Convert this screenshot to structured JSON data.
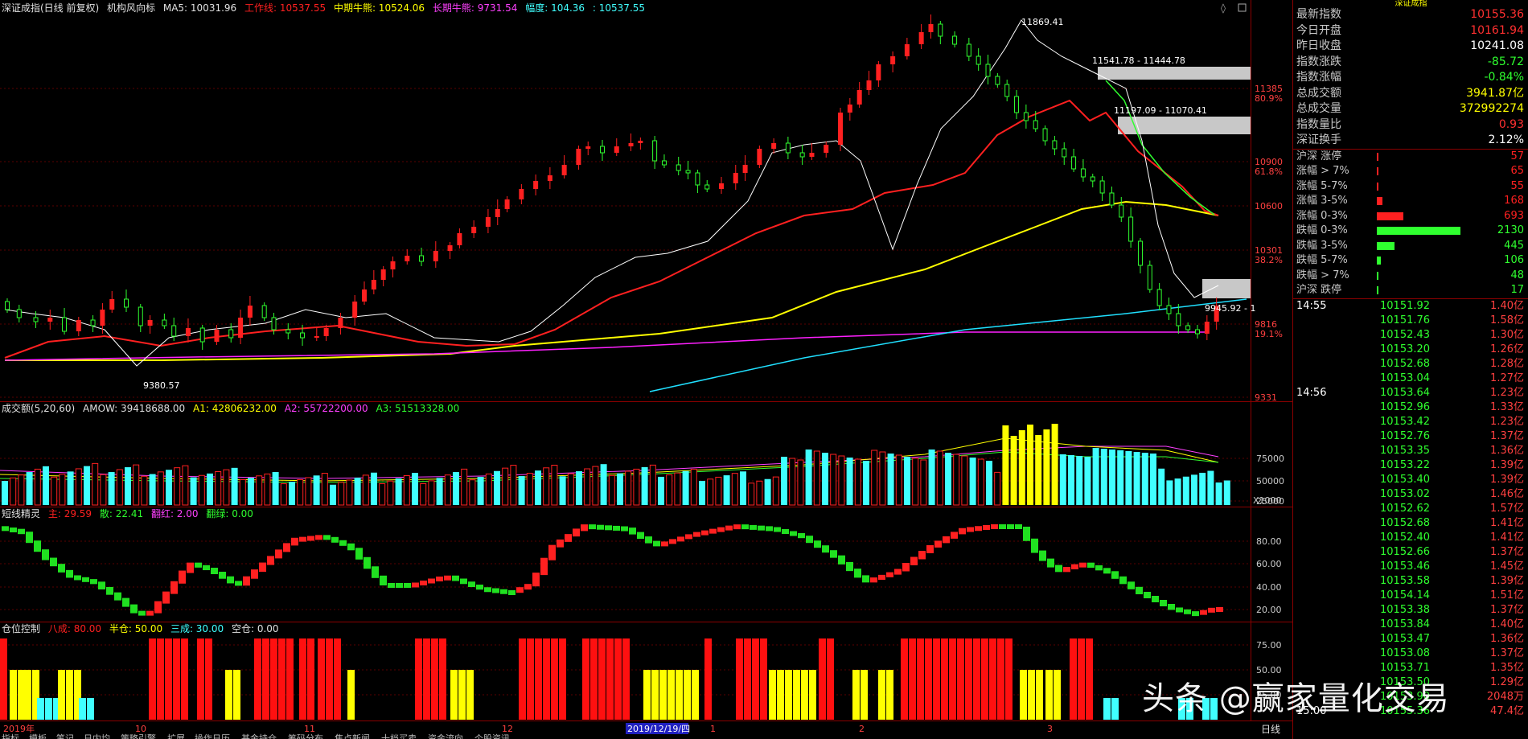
{
  "chart_header": {
    "name": "深证成指(日线 前复权)",
    "indicator": "机构风向标",
    "ma5": "MA5: 10031.96",
    "work": "工作线: 10537.55",
    "mid": "中期牛熊: 10524.06",
    "long": "长期牛熊: 9731.54",
    "amp": "幅度: 104.36",
    "last": ": 10537.55"
  },
  "price_labels": {
    "high": "11869.41",
    "zone1": "11541.78 - 11444.78",
    "zone2": "11197.09 - 11070.41",
    "low": "9380.57",
    "right": "9945.92 - 1"
  },
  "price_axis": [
    {
      "v": "11385",
      "p": "80.9%"
    },
    {
      "v": "10900",
      "p": "61.8%"
    },
    {
      "v": "10600",
      "p": ""
    },
    {
      "v": "10301",
      "p": "38.2%"
    },
    {
      "v": "9816",
      "p": "19.1%"
    },
    {
      "v": "9331",
      "p": ""
    }
  ],
  "volume_header": {
    "name": "成交额(5,20,60)",
    "amow": "AMOW: 39418688.00",
    "a1": "A1: 42806232.00",
    "a2": "A2: 55722200.00",
    "a3": "A3: 51513328.00"
  },
  "volume_axis": [
    "75000",
    "50000",
    "25000"
  ],
  "volume_unit": "X1000",
  "osc_header": {
    "name": "短线精灵",
    "main": "主: 29.59",
    "san": "散: 22.41",
    "hong": "翻红: 2.00",
    "lv": "翻绿: 0.00"
  },
  "osc_axis": [
    "80.00",
    "60.00",
    "40.00",
    "20.00"
  ],
  "pos_header": {
    "name": "仓位控制",
    "ba": "八成: 80.00",
    "ban": "半仓: 50.00",
    "san": "三成: 30.00",
    "kong": "空仓: 0.00"
  },
  "pos_axis": [
    "75.00",
    "50.00",
    "25.00"
  ],
  "date_axis": [
    "2019年",
    "10",
    "11",
    "12",
    "2019/12/19/四",
    "1",
    "2",
    "3"
  ],
  "period_label": "日线",
  "bottom_tabs": [
    "指标",
    "模板",
    "笔记",
    "日内均",
    "策略引擎",
    "扩展",
    "操作日历",
    "基金持仓",
    "筹码分布",
    "焦点新闻",
    "十档买卖",
    "资金流向",
    "个股资讯"
  ],
  "quote": {
    "title": "深证成指",
    "rows": [
      {
        "label": "最新指数",
        "value": "10155.36",
        "color": "#ff3030"
      },
      {
        "label": "今日开盘",
        "value": "10161.94",
        "color": "#ff3030"
      },
      {
        "label": "昨日收盘",
        "value": "10241.08",
        "color": "#ffffff"
      },
      {
        "label": "指数涨跌",
        "value": "-85.72",
        "color": "#2fff2f"
      },
      {
        "label": "指数涨幅",
        "value": "-0.84%",
        "color": "#2fff2f"
      },
      {
        "label": "总成交额",
        "value": "3941.87亿",
        "color": "#ffff00"
      },
      {
        "label": "总成交量",
        "value": "372992274",
        "color": "#ffff00"
      },
      {
        "label": "指数量比",
        "value": "0.93",
        "color": "#ff3030"
      },
      {
        "label": "深证换手",
        "value": "2.12%",
        "color": "#ffffff"
      }
    ]
  },
  "breadth": [
    {
      "label": "沪深 涨停",
      "value": "57",
      "color": "#ff2020",
      "frac": 0.02
    },
    {
      "label": "涨幅 > 7%",
      "value": "65",
      "color": "#ff2020",
      "frac": 0.02
    },
    {
      "label": "涨幅 5-7%",
      "value": "55",
      "color": "#ff2020",
      "frac": 0.02
    },
    {
      "label": "涨幅 3-5%",
      "value": "168",
      "color": "#ff2020",
      "frac": 0.07
    },
    {
      "label": "涨幅 0-3%",
      "value": "693",
      "color": "#ff2020",
      "frac": 0.32
    },
    {
      "label": "跌幅 0-3%",
      "value": "2130",
      "color": "#2fff2f",
      "frac": 1.0
    },
    {
      "label": "跌幅 3-5%",
      "value": "445",
      "color": "#2fff2f",
      "frac": 0.21
    },
    {
      "label": "跌幅 5-7%",
      "value": "106",
      "color": "#2fff2f",
      "frac": 0.05
    },
    {
      "label": "跌幅 > 7%",
      "value": "48",
      "color": "#2fff2f",
      "frac": 0.02
    },
    {
      "label": "沪深 跌停",
      "value": "17",
      "color": "#2fff2f",
      "frac": 0.01
    }
  ],
  "ticks": [
    {
      "time": "14:55",
      "price": "10151.92",
      "vol": "1.40亿"
    },
    {
      "time": "",
      "price": "10151.76",
      "vol": "1.58亿"
    },
    {
      "time": "",
      "price": "10152.43",
      "vol": "1.30亿"
    },
    {
      "time": "",
      "price": "10153.20",
      "vol": "1.26亿"
    },
    {
      "time": "",
      "price": "10152.68",
      "vol": "1.28亿"
    },
    {
      "time": "",
      "price": "10153.04",
      "vol": "1.27亿"
    },
    {
      "time": "14:56",
      "price": "10153.64",
      "vol": "1.23亿"
    },
    {
      "time": "",
      "price": "10152.96",
      "vol": "1.33亿"
    },
    {
      "time": "",
      "price": "10153.42",
      "vol": "1.23亿"
    },
    {
      "time": "",
      "price": "10152.76",
      "vol": "1.37亿"
    },
    {
      "time": "",
      "price": "10153.35",
      "vol": "1.36亿"
    },
    {
      "time": "",
      "price": "10153.22",
      "vol": "1.39亿"
    },
    {
      "time": "",
      "price": "10153.40",
      "vol": "1.39亿"
    },
    {
      "time": "",
      "price": "10153.02",
      "vol": "1.46亿"
    },
    {
      "time": "",
      "price": "10152.62",
      "vol": "1.57亿"
    },
    {
      "time": "",
      "price": "10152.68",
      "vol": "1.41亿"
    },
    {
      "time": "",
      "price": "10152.40",
      "vol": "1.41亿"
    },
    {
      "time": "",
      "price": "10152.66",
      "vol": "1.37亿"
    },
    {
      "time": "",
      "price": "10153.46",
      "vol": "1.45亿"
    },
    {
      "time": "",
      "price": "10153.58",
      "vol": "1.39亿"
    },
    {
      "time": "",
      "price": "10154.14",
      "vol": "1.51亿"
    },
    {
      "time": "",
      "price": "10153.38",
      "vol": "1.37亿"
    },
    {
      "time": "",
      "price": "10153.84",
      "vol": "1.40亿"
    },
    {
      "time": "",
      "price": "10153.47",
      "vol": "1.36亿"
    },
    {
      "time": "",
      "price": "10153.08",
      "vol": "1.37亿"
    },
    {
      "time": "",
      "price": "10153.71",
      "vol": "1.35亿"
    },
    {
      "time": "",
      "price": "10153.50",
      "vol": "1.29亿"
    },
    {
      "time": "",
      "price": "10153.90",
      "vol": "2048万"
    },
    {
      "time": "15:00",
      "price": "10155.36",
      "vol": "47.4亿"
    }
  ],
  "watermark": "头条 @赢家量化交易"
}
